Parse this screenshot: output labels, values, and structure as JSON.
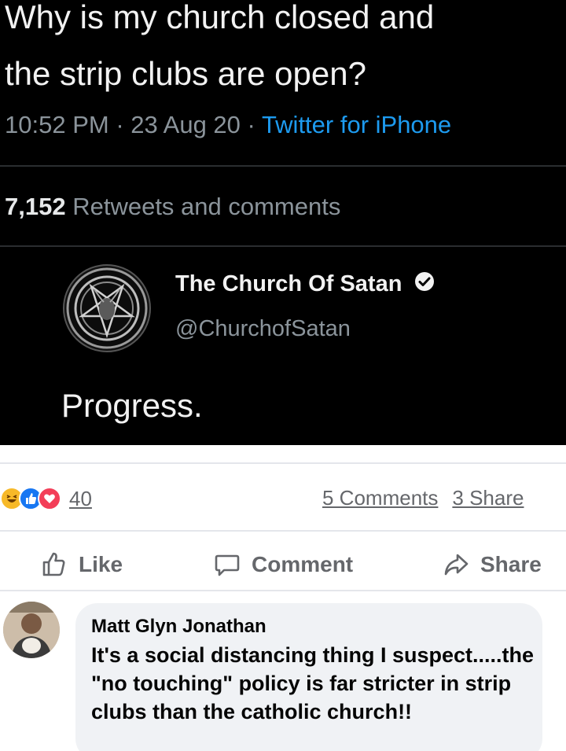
{
  "tweet": {
    "text_line1": "Why is my church closed and",
    "text_line2": "the strip clubs are open?",
    "time": "10:52 PM",
    "date": "23 Aug 20",
    "separator": "·",
    "source": "Twitter for iPhone",
    "retweets_count": "7,152",
    "retweets_label": "Retweets and comments",
    "source_color": "#1d9bf0"
  },
  "quote": {
    "name": "The Church Of Satan",
    "handle": "@ChurchofSatan",
    "text": "Progress.",
    "avatar_icon": "sigil-of-baphomet-icon",
    "verified_icon": "verified-badge-icon"
  },
  "post": {
    "reaction_icons": [
      "haha-reaction-icon",
      "like-reaction-icon",
      "love-reaction-icon"
    ],
    "reaction_count": "40",
    "comments_count": "5 Comments",
    "shares_count": "3 Share",
    "actions": {
      "like": "Like",
      "comment": "Comment",
      "share": "Share"
    }
  },
  "comment": {
    "author": "Matt Glyn Jonathan",
    "text": "It's a social distancing thing I suspect.....the \"no touching\" policy is far stricter in strip clubs than the catholic church!!"
  }
}
